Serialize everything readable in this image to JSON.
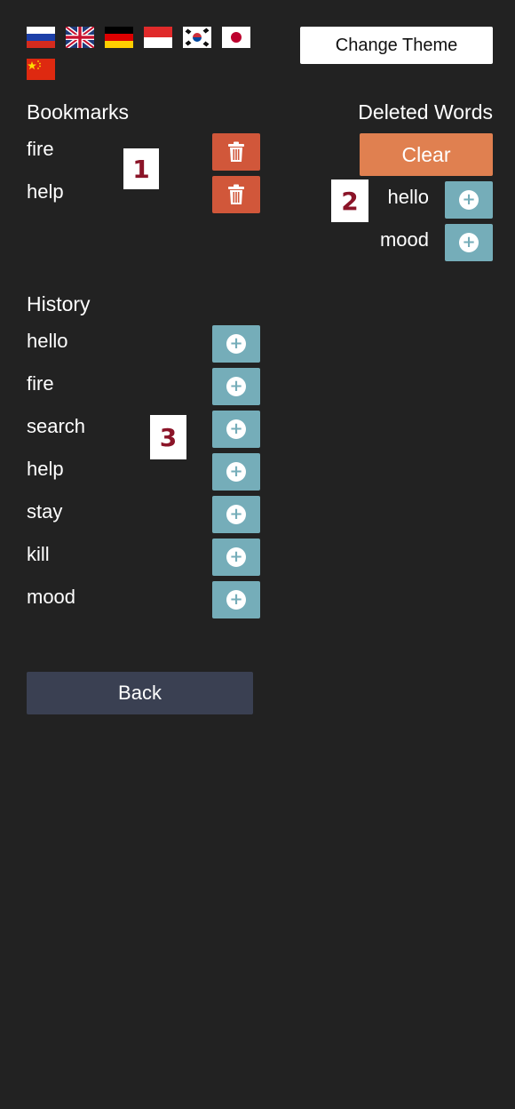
{
  "languages": [
    {
      "name": "Russian",
      "icon": "flag-ru-icon"
    },
    {
      "name": "English",
      "icon": "flag-gb-icon"
    },
    {
      "name": "German",
      "icon": "flag-de-icon"
    },
    {
      "name": "Indonesian",
      "icon": "flag-id-icon"
    },
    {
      "name": "Korean",
      "icon": "flag-kr-icon"
    },
    {
      "name": "Japanese",
      "icon": "flag-jp-icon"
    },
    {
      "name": "Chinese",
      "icon": "flag-cn-icon"
    }
  ],
  "header": {
    "change_theme_label": "Change Theme"
  },
  "bookmarks": {
    "heading": "Bookmarks",
    "items": [
      {
        "word": "fire"
      },
      {
        "word": "help"
      }
    ],
    "delete_icon": "trash-icon"
  },
  "deleted_words": {
    "heading": "Deleted Words",
    "clear_label": "Clear",
    "items": [
      {
        "word": "hello"
      },
      {
        "word": "mood"
      }
    ],
    "restore_icon": "plus-circle-icon"
  },
  "history": {
    "heading": "History",
    "items": [
      {
        "word": "hello"
      },
      {
        "word": "fire"
      },
      {
        "word": "search"
      },
      {
        "word": "help"
      },
      {
        "word": "stay"
      },
      {
        "word": "kill"
      },
      {
        "word": "mood"
      }
    ],
    "add_icon": "plus-circle-icon"
  },
  "markers": [
    "1",
    "2",
    "3"
  ],
  "back_label": "Back",
  "colors": {
    "background": "#222222",
    "delete_button": "#d1573a",
    "add_button": "#75adb9",
    "clear_button": "#e08050",
    "back_button": "#3a4052",
    "marker_text": "#8b1428"
  }
}
